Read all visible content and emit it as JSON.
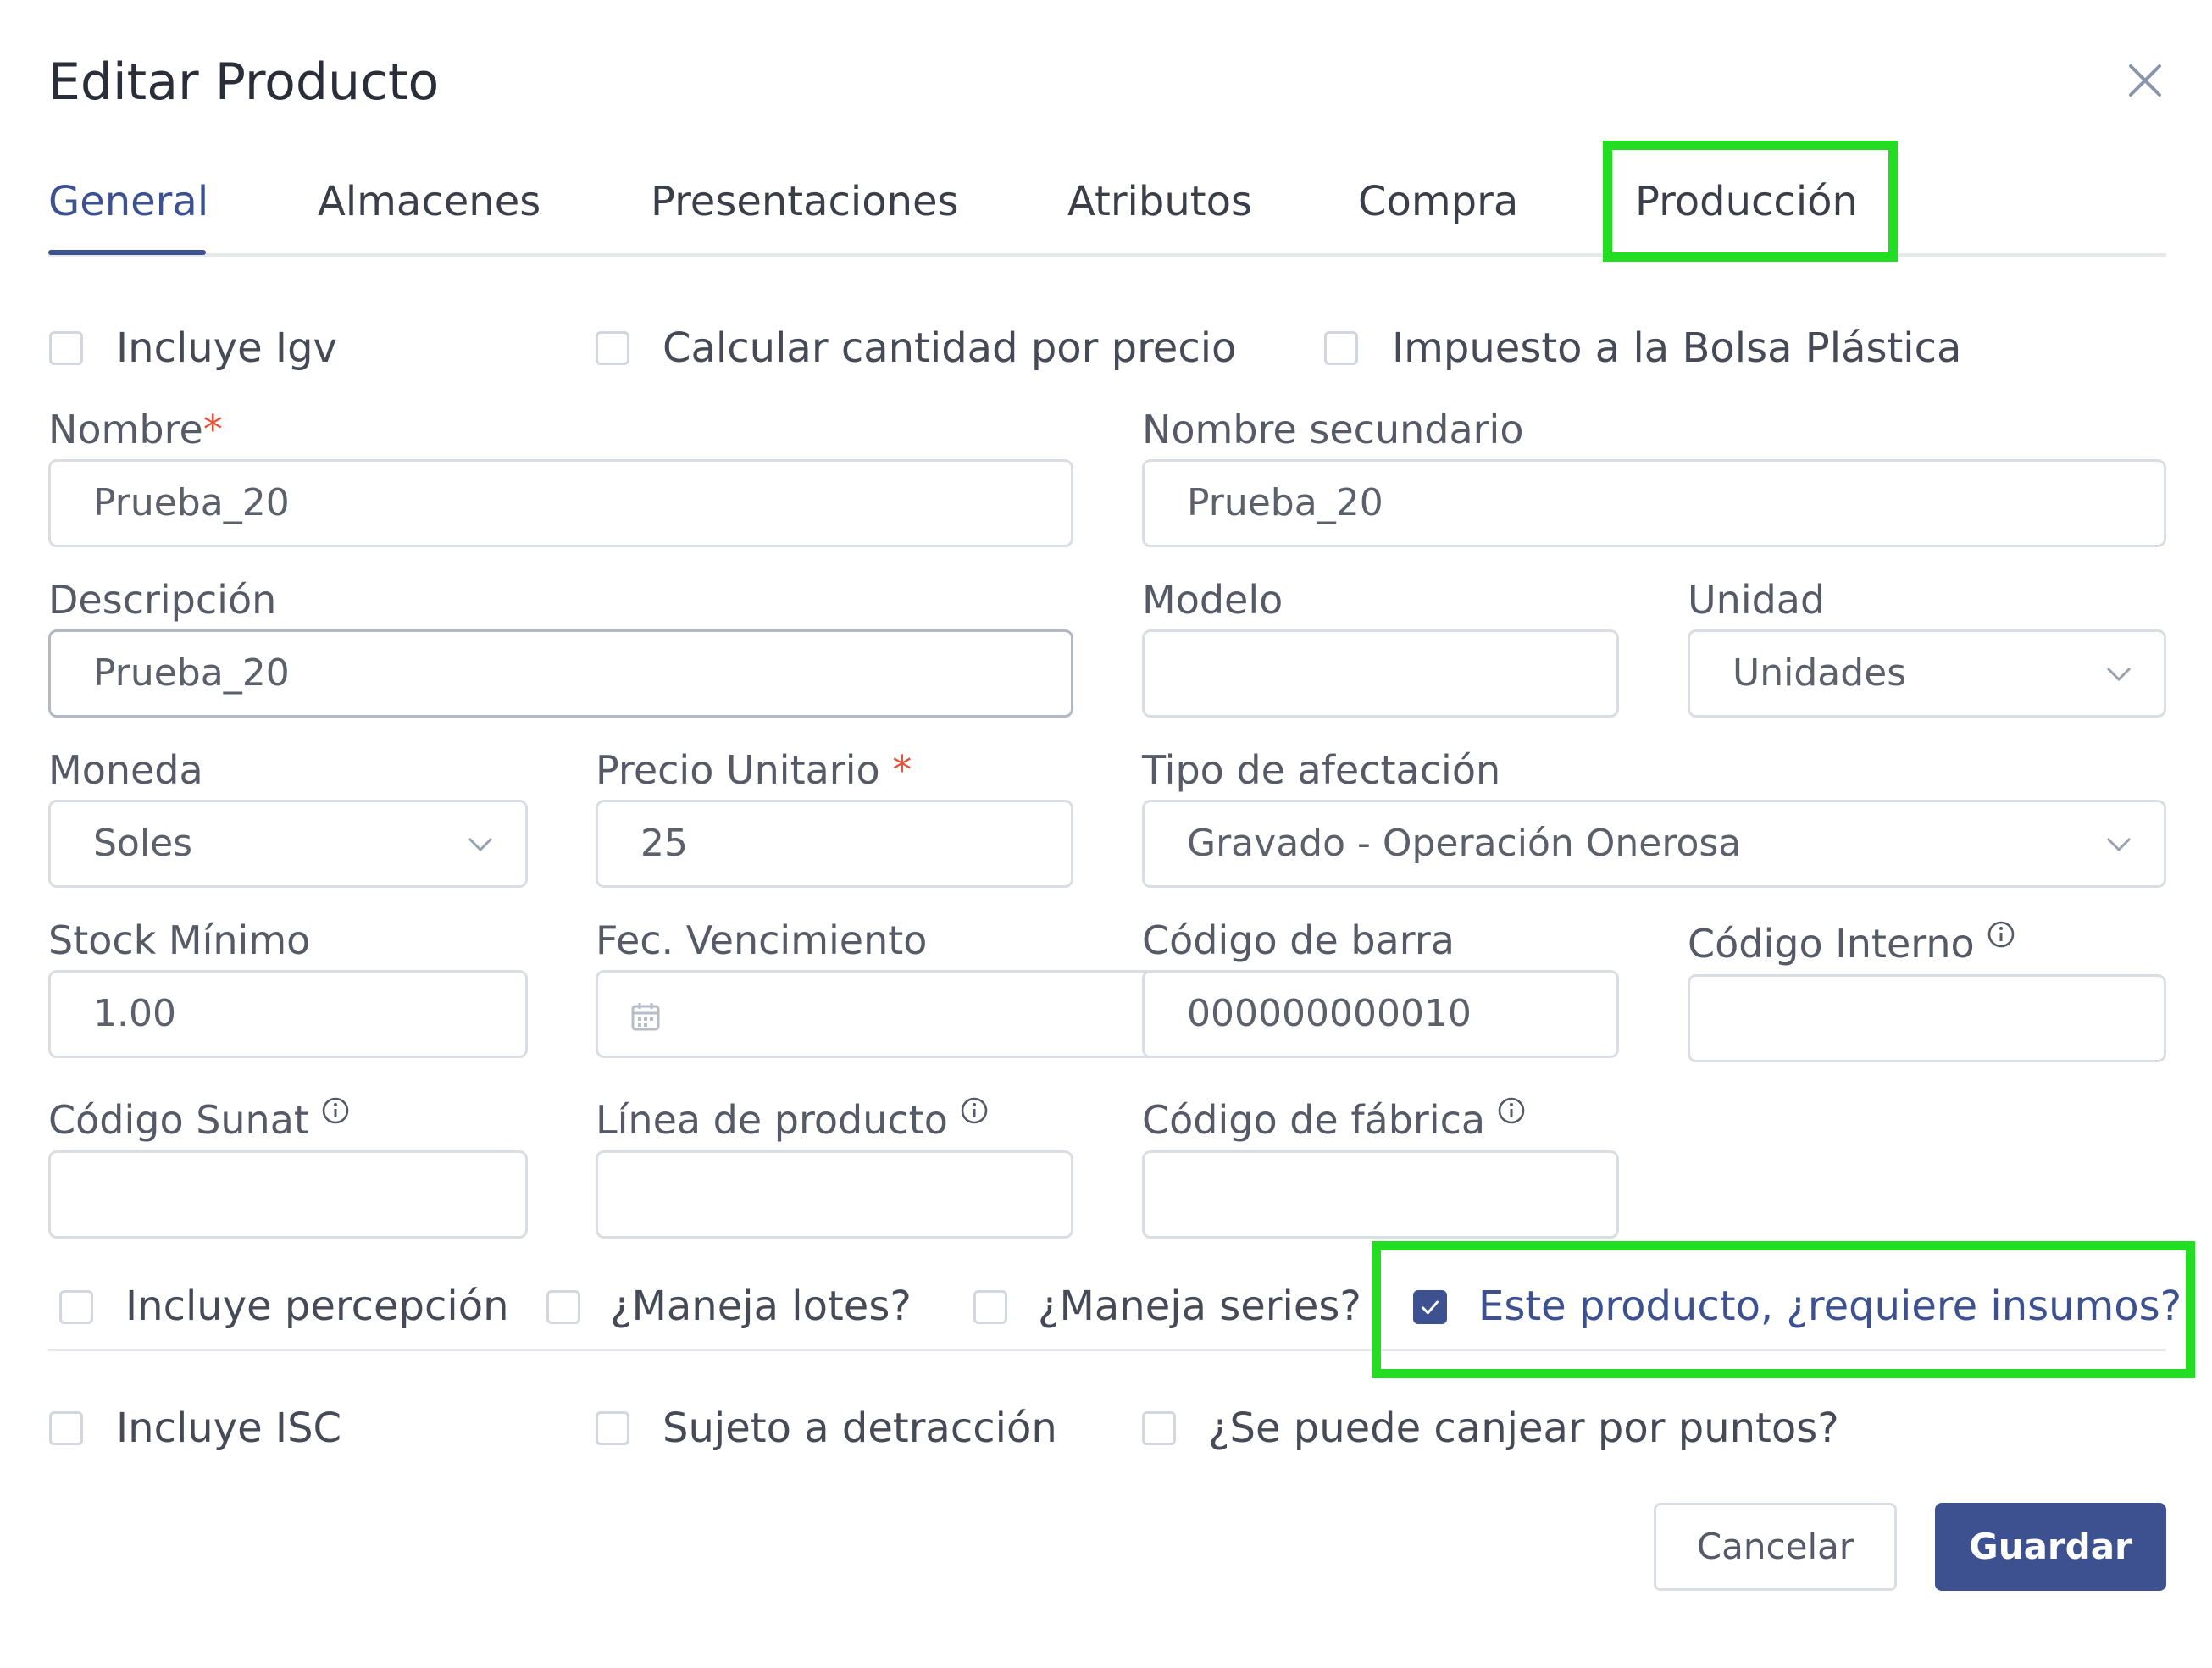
{
  "dialog": {
    "title": "Editar Producto"
  },
  "tabs": [
    {
      "label": "General"
    },
    {
      "label": "Almacenes"
    },
    {
      "label": "Presentaciones"
    },
    {
      "label": "Atributos"
    },
    {
      "label": "Compra"
    },
    {
      "label": "Producción"
    }
  ],
  "checkboxes_top": [
    {
      "label": "Incluye Igv",
      "checked": false
    },
    {
      "label": "Calcular cantidad por precio",
      "checked": false
    },
    {
      "label": "Impuesto a la Bolsa Plástica",
      "checked": false
    }
  ],
  "fields": {
    "nombre": {
      "label": "Nombre",
      "required": "*",
      "value": "Prueba_20"
    },
    "nombre_secundario": {
      "label": "Nombre secundario",
      "value": "Prueba_20"
    },
    "descripcion": {
      "label": "Descripción",
      "value": "Prueba_20"
    },
    "modelo": {
      "label": "Modelo",
      "value": ""
    },
    "unidad": {
      "label": "Unidad",
      "value": "Unidades"
    },
    "moneda": {
      "label": "Moneda",
      "value": "Soles"
    },
    "precio_unitario": {
      "label": "Precio Unitario",
      "required": "*",
      "value": "25"
    },
    "tipo_afectacion": {
      "label": "Tipo de afectación",
      "value": "Gravado - Operación Onerosa"
    },
    "stock_minimo": {
      "label": "Stock Mínimo",
      "value": "1.00"
    },
    "fec_vencimiento": {
      "label": "Fec. Vencimiento",
      "value": ""
    },
    "codigo_barra": {
      "label": "Código de barra",
      "value": "000000000010"
    },
    "codigo_interno": {
      "label": "Código Interno",
      "value": ""
    },
    "codigo_sunat": {
      "label": "Código Sunat",
      "value": ""
    },
    "linea_producto": {
      "label": "Línea de producto",
      "value": ""
    },
    "codigo_fabrica": {
      "label": "Código de fábrica",
      "value": ""
    }
  },
  "checkboxes_mid": [
    {
      "label": "Incluye percepción",
      "checked": false
    },
    {
      "label": "¿Maneja lotes?",
      "checked": false
    },
    {
      "label": "¿Maneja series?",
      "checked": false
    },
    {
      "label": "Este producto, ¿requiere insumos?",
      "checked": true
    }
  ],
  "checkboxes_bottom": [
    {
      "label": "Incluye ISC",
      "checked": false
    },
    {
      "label": "Sujeto a detracción",
      "checked": false
    },
    {
      "label": "¿Se puede canjear por puntos?",
      "checked": false
    }
  ],
  "buttons": {
    "cancel": "Cancelar",
    "save": "Guardar"
  },
  "colors": {
    "primary": "#3d5191",
    "highlight": "#22dd22",
    "required": "#e5533d"
  },
  "icons": [
    "close-icon",
    "info-icon",
    "chevron-down-icon",
    "calendar-icon",
    "check-icon"
  ]
}
